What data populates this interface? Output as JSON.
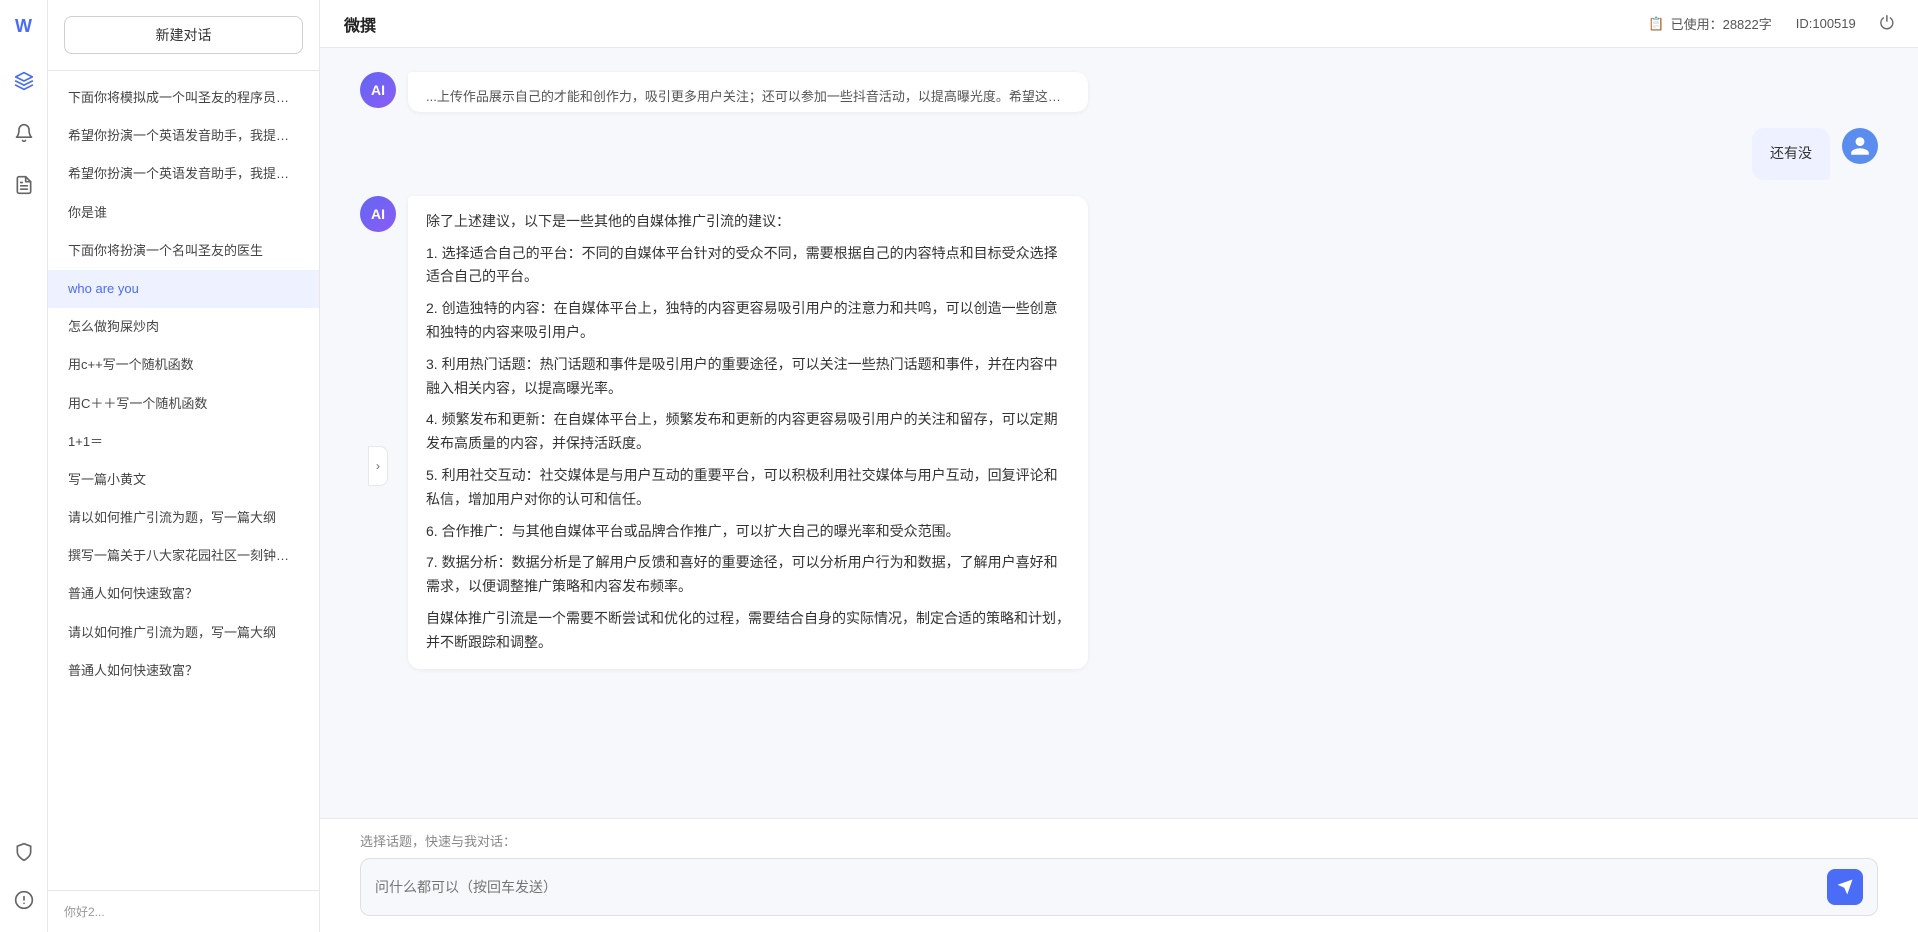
{
  "app": {
    "title": "微撰",
    "logo": "W"
  },
  "topbar": {
    "usage_label": "已使用：28822字",
    "usage_icon": "📋",
    "id_label": "ID:100519",
    "power_icon": "⏻"
  },
  "sidebar": {
    "new_chat_label": "新建对话",
    "items": [
      {
        "id": 1,
        "text": "下面你将模拟成一个叫圣友的程序员，我说..."
      },
      {
        "id": 2,
        "text": "希望你扮演一个英语发音助手，我提供给你..."
      },
      {
        "id": 3,
        "text": "希望你扮演一个英语发音助手，我提供给你..."
      },
      {
        "id": 4,
        "text": "你是谁"
      },
      {
        "id": 5,
        "text": "下面你将扮演一个名叫圣友的医生"
      },
      {
        "id": 6,
        "text": "who are you",
        "active": true
      },
      {
        "id": 7,
        "text": "怎么做狗屎炒肉"
      },
      {
        "id": 8,
        "text": "用c++写一个随机函数"
      },
      {
        "id": 9,
        "text": "用C＋＋写一个随机函数"
      },
      {
        "id": 10,
        "text": "1+1＝"
      },
      {
        "id": 11,
        "text": "写一篇小黄文"
      },
      {
        "id": 12,
        "text": "请以如何推广引流为题，写一篇大纲"
      },
      {
        "id": 13,
        "text": "撰写一篇关于八大家花园社区一刻钟便民生..."
      },
      {
        "id": 14,
        "text": "普通人如何快速致富？"
      },
      {
        "id": 15,
        "text": "请以如何推广引流为题，写一篇大纲"
      },
      {
        "id": 16,
        "text": "普通人如何快速致富？"
      }
    ],
    "bottom_text": "你好2..."
  },
  "chat": {
    "messages": [
      {
        "id": 1,
        "role": "user",
        "text": "还有没",
        "avatar_type": "user"
      },
      {
        "id": 2,
        "role": "assistant",
        "text": "除了上述建议，以下是一些其他的自媒体推广引流的建议：\n\n1. 选择适合自己的平台：不同的自媒体平台针对的受众不同，需要根据自己的内容特点和目标受众选择适合自己的平台。\n\n2. 创造独特的内容：在自媒体平台上，独特的内容更容易吸引用户的注意力和共鸣，可以创造一些创意和独特的内容来吸引用户。\n\n3. 利用热门话题：热门话题和事件是吸引用户的重要途径，可以关注一些热门话题和事件，并在内容中融入相关内容，以提高曝光率。\n\n4. 频繁发布和更新：在自媒体平台上，频繁发布和更新的内容更容易吸引用户的关注和留存，可以定期发布高质量的内容，并保持活跃度。\n\n5. 利用社交互动：社交媒体是与用户互动的重要平台，可以积极利用社交媒体与用户互动，回复评论和私信，增加用户对你的认可和信任。\n\n6. 合作推广：与其他自媒体平台或品牌合作推广，可以扩大自己的曝光率和受众范围。\n\n7. 数据分析：数据分析是了解用户反馈和喜好的重要途径，可以分析用户行为和数据，了解用户喜好和需求，以便调整推广策略和内容发布频率。\n\n自媒体推广引流是一个需要不断尝试和优化的过程，需要结合自身的实际情况，制定合适的策略和计划，并不断跟踪和调整。",
        "avatar_type": "ai"
      }
    ]
  },
  "input": {
    "quick_topics_label": "选择话题，快速与我对话：",
    "placeholder": "问什么都可以（按回车发送）",
    "send_icon": "➤"
  },
  "icons": {
    "hexagon": "⬡",
    "bell": "🔔",
    "file": "📄",
    "shield": "🛡",
    "info": "ℹ",
    "arrow_right": "›",
    "collapse": "‹"
  }
}
